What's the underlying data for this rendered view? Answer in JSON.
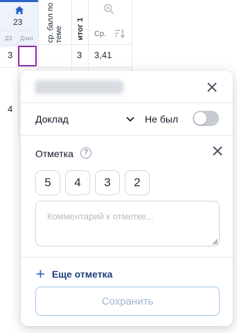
{
  "table": {
    "header": {
      "day_number": "23",
      "sub_col_1": "ДЗ",
      "sub_col_2": "Докл",
      "avg_topic_label": "ср. балл по теме",
      "total_label": "итог 1",
      "avg_short": "Ср."
    },
    "rows": [
      {
        "grade": "3",
        "total": "3",
        "avg": "3,41"
      },
      {
        "grade": "4"
      }
    ],
    "icons": {
      "today": "home-icon",
      "zoom": "zoom-in-icon",
      "sort": "sort-icon"
    },
    "accent_color": "#2b63c4",
    "selected_cell_color": "#8e24aa"
  },
  "popup": {
    "student_name_hidden": true,
    "work_type": {
      "value": "Доклад"
    },
    "absent": {
      "label": "Не был",
      "checked": false
    },
    "grade_section": {
      "title": "Отметка",
      "help_symbol": "?",
      "options": [
        "5",
        "4",
        "3",
        "2"
      ]
    },
    "comment": {
      "placeholder": "Комментарий к отметке..."
    },
    "add_grade": {
      "plus": "+",
      "label": "Еще отметка"
    },
    "save": {
      "label": "Сохранить",
      "disabled": true
    },
    "icons": {
      "close": "close-icon",
      "dropdown": "chevron-down-icon",
      "help": "question-icon",
      "add": "plus-icon"
    }
  }
}
